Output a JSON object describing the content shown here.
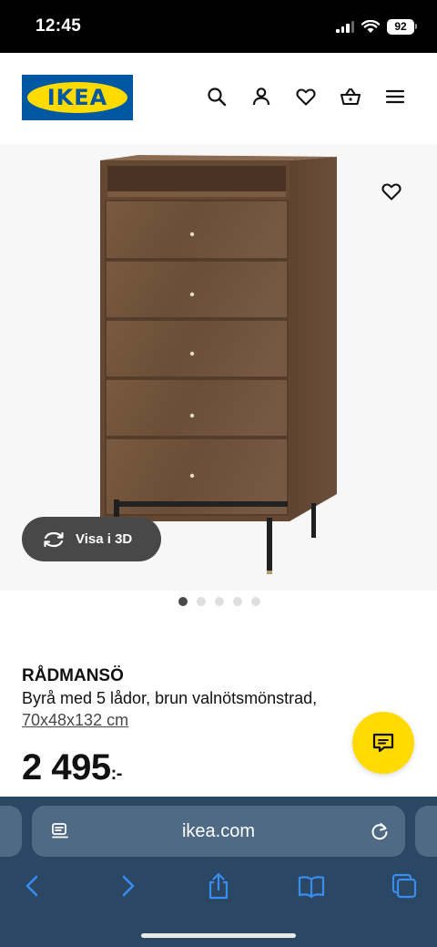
{
  "status_bar": {
    "time": "12:45",
    "battery": "92"
  },
  "header": {
    "logo_text": "IKEA",
    "brand_colors": {
      "blue": "#0058a3",
      "yellow": "#ffdb00"
    },
    "icons": [
      "search-icon",
      "profile-icon",
      "heart-icon",
      "basket-icon",
      "menu-icon"
    ]
  },
  "product": {
    "view_3d_label": "Visa i 3D",
    "image_count": 5,
    "active_image": 0,
    "name": "RÅDMANSÖ",
    "description": "Byrå med 5 lådor, brun valnötsmönstrad,",
    "size": "70x48x132 cm",
    "price": "2 495",
    "price_suffix": ":-"
  },
  "chat": {
    "icon": "chat-icon"
  },
  "browser": {
    "url": "ikea.com",
    "toolbar_icons": [
      "back-icon",
      "forward-icon",
      "share-icon",
      "bookmarks-icon",
      "tabs-icon"
    ]
  }
}
